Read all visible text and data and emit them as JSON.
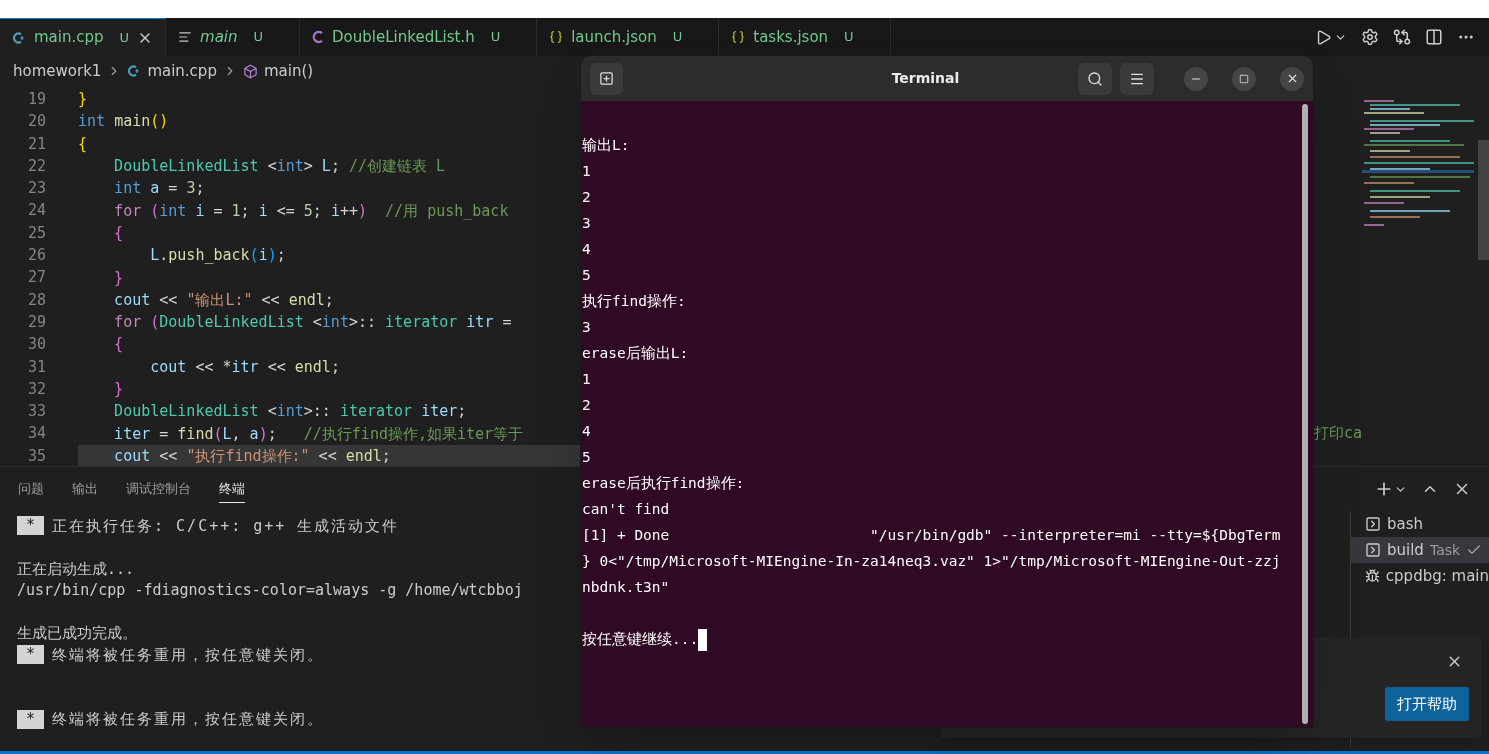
{
  "tabs": [
    {
      "label": "main.cpp",
      "badge": "U",
      "kind": "cpp",
      "selected": true,
      "preview": false
    },
    {
      "label": "main",
      "badge": "U",
      "kind": "list",
      "selected": false,
      "preview": true
    },
    {
      "label": "DoubleLinkedList.h",
      "badge": "U",
      "kind": "header",
      "selected": false,
      "preview": false
    },
    {
      "label": "launch.json",
      "badge": "U",
      "kind": "json",
      "selected": false,
      "preview": false
    },
    {
      "label": "tasks.json",
      "badge": "U",
      "kind": "json",
      "selected": false,
      "preview": false
    }
  ],
  "breadcrumb": [
    {
      "label": "homework1",
      "kind": "folder"
    },
    {
      "label": "main.cpp",
      "kind": "cpp"
    },
    {
      "label": "main()",
      "kind": "method"
    }
  ],
  "editor": {
    "lines": [
      {
        "number": "19",
        "current": false,
        "segments": [
          {
            "text": "}",
            "kind": "b1"
          }
        ]
      },
      {
        "number": "20",
        "current": false,
        "segments": [
          {
            "text": "int ",
            "kind": "kw"
          },
          {
            "text": "main",
            "kind": "fn"
          },
          {
            "text": "()",
            "kind": "b1"
          }
        ]
      },
      {
        "number": "21",
        "current": false,
        "segments": [
          {
            "text": "{",
            "kind": "b1"
          }
        ]
      },
      {
        "number": "22",
        "current": false,
        "segments": [
          {
            "text": "    DoubleLinkedList",
            "kind": "type"
          },
          {
            "text": " <",
            "kind": "plain"
          },
          {
            "text": "int",
            "kind": "kw"
          },
          {
            "text": "> ",
            "kind": "plain"
          },
          {
            "text": "L",
            "kind": "var"
          },
          {
            "text": "; ",
            "kind": "plain"
          },
          {
            "text": "//创建链表 L",
            "kind": "cmt"
          }
        ]
      },
      {
        "number": "23",
        "current": false,
        "segments": [
          {
            "text": "    int ",
            "kind": "kw"
          },
          {
            "text": "a",
            "kind": "var"
          },
          {
            "text": " = ",
            "kind": "plain"
          },
          {
            "text": "3",
            "kind": "num"
          },
          {
            "text": ";",
            "kind": "plain"
          }
        ]
      },
      {
        "number": "24",
        "current": false,
        "segments": [
          {
            "text": "    for ",
            "kind": "ctrl"
          },
          {
            "text": "(",
            "kind": "b2"
          },
          {
            "text": "int ",
            "kind": "kw"
          },
          {
            "text": "i",
            "kind": "var"
          },
          {
            "text": " = ",
            "kind": "plain"
          },
          {
            "text": "1",
            "kind": "num"
          },
          {
            "text": "; ",
            "kind": "plain"
          },
          {
            "text": "i",
            "kind": "var"
          },
          {
            "text": " <= ",
            "kind": "plain"
          },
          {
            "text": "5",
            "kind": "num"
          },
          {
            "text": "; ",
            "kind": "plain"
          },
          {
            "text": "i",
            "kind": "var"
          },
          {
            "text": "++",
            "kind": "plain"
          },
          {
            "text": ")",
            "kind": "b2"
          },
          {
            "text": "  //用 push_back",
            "kind": "cmt"
          }
        ]
      },
      {
        "number": "25",
        "current": false,
        "segments": [
          {
            "text": "    {",
            "kind": "b2"
          }
        ]
      },
      {
        "number": "26",
        "current": false,
        "segments": [
          {
            "text": "        L",
            "kind": "var"
          },
          {
            "text": ".",
            "kind": "plain"
          },
          {
            "text": "push_back",
            "kind": "fn"
          },
          {
            "text": "(",
            "kind": "b3"
          },
          {
            "text": "i",
            "kind": "var"
          },
          {
            "text": ")",
            "kind": "b3"
          },
          {
            "text": ";",
            "kind": "plain"
          }
        ]
      },
      {
        "number": "27",
        "current": false,
        "segments": [
          {
            "text": "    }",
            "kind": "b2"
          }
        ]
      },
      {
        "number": "28",
        "current": false,
        "segments": [
          {
            "text": "    cout",
            "kind": "var"
          },
          {
            "text": " << ",
            "kind": "plain"
          },
          {
            "text": "\"输出L:\"",
            "kind": "str"
          },
          {
            "text": " << ",
            "kind": "plain"
          },
          {
            "text": "endl",
            "kind": "fn"
          },
          {
            "text": ";",
            "kind": "plain"
          }
        ]
      },
      {
        "number": "29",
        "current": false,
        "segments": [
          {
            "text": "    for ",
            "kind": "ctrl"
          },
          {
            "text": "(",
            "kind": "b2"
          },
          {
            "text": "DoubleLinkedList",
            "kind": "type"
          },
          {
            "text": " <",
            "kind": "plain"
          },
          {
            "text": "int",
            "kind": "kw"
          },
          {
            "text": ">:: ",
            "kind": "plain"
          },
          {
            "text": "iterator ",
            "kind": "type"
          },
          {
            "text": "itr",
            "kind": "var"
          },
          {
            "text": " =",
            "kind": "plain"
          }
        ]
      },
      {
        "number": "30",
        "current": false,
        "segments": [
          {
            "text": "    {",
            "kind": "b2"
          }
        ]
      },
      {
        "number": "31",
        "current": false,
        "segments": [
          {
            "text": "        cout",
            "kind": "var"
          },
          {
            "text": " << *",
            "kind": "plain"
          },
          {
            "text": "itr",
            "kind": "var"
          },
          {
            "text": " << ",
            "kind": "plain"
          },
          {
            "text": "endl",
            "kind": "fn"
          },
          {
            "text": ";",
            "kind": "plain"
          }
        ]
      },
      {
        "number": "32",
        "current": false,
        "segments": [
          {
            "text": "    }",
            "kind": "b2"
          }
        ]
      },
      {
        "number": "33",
        "current": false,
        "segments": [
          {
            "text": "    DoubleLinkedList",
            "kind": "type"
          },
          {
            "text": " <",
            "kind": "plain"
          },
          {
            "text": "int",
            "kind": "kw"
          },
          {
            "text": ">:: ",
            "kind": "plain"
          },
          {
            "text": "iterator ",
            "kind": "type"
          },
          {
            "text": "iter",
            "kind": "var"
          },
          {
            "text": ";",
            "kind": "plain"
          }
        ]
      },
      {
        "number": "34",
        "current": false,
        "tail": "打印ca",
        "segments": [
          {
            "text": "    iter",
            "kind": "var"
          },
          {
            "text": " = ",
            "kind": "plain"
          },
          {
            "text": "find",
            "kind": "fn"
          },
          {
            "text": "(",
            "kind": "b2"
          },
          {
            "text": "L",
            "kind": "var"
          },
          {
            "text": ", ",
            "kind": "plain"
          },
          {
            "text": "a",
            "kind": "var"
          },
          {
            "text": ")",
            "kind": "b2"
          },
          {
            "text": ";",
            "kind": "plain"
          },
          {
            "text": "   //执行find操作,如果iter等于",
            "kind": "cmt"
          }
        ]
      },
      {
        "number": "35",
        "current": true,
        "segments": [
          {
            "text": "    cout",
            "kind": "var"
          },
          {
            "text": " << ",
            "kind": "plain"
          },
          {
            "text": "\"执行find操作:\"",
            "kind": "str"
          },
          {
            "text": " << ",
            "kind": "plain"
          },
          {
            "text": "endl",
            "kind": "fn"
          },
          {
            "text": ";",
            "kind": "plain"
          }
        ]
      }
    ]
  },
  "panel": {
    "tabs": [
      {
        "label": "问题",
        "selected": false
      },
      {
        "label": "输出",
        "selected": false
      },
      {
        "label": "调试控制台",
        "selected": false
      },
      {
        "label": "终端",
        "selected": true
      }
    ],
    "output": [
      {
        "kind": "task",
        "badge": "*",
        "text": "正在执行任务: C/C++: g++ 生成活动文件"
      },
      {
        "kind": "blank"
      },
      {
        "kind": "text",
        "text": "正在启动生成..."
      },
      {
        "kind": "text",
        "text": "/usr/bin/cpp -fdiagnostics-color=always -g /home/wtcbboj"
      },
      {
        "kind": "blank"
      },
      {
        "kind": "text",
        "text": "生成已成功完成。"
      },
      {
        "kind": "task",
        "badge": "*",
        "text": "终端将被任务重用，按任意键关闭。"
      },
      {
        "kind": "blank"
      },
      {
        "kind": "blank"
      },
      {
        "kind": "task",
        "badge": "*",
        "text": "终端将被任务重用，按任意键关闭。"
      }
    ],
    "sessions": [
      {
        "label": "bash",
        "kind": "shell",
        "selected": false,
        "done": false
      },
      {
        "label": "build",
        "note": "Task",
        "kind": "shell",
        "selected": true,
        "done": true
      },
      {
        "label": "cppdbg: main",
        "kind": "debug",
        "selected": false,
        "done": false
      }
    ]
  },
  "notification": {
    "button": "打开帮助"
  },
  "terminal_window": {
    "title": "Terminal",
    "cursor": true,
    "lines": [
      {
        "kind": "blank"
      },
      {
        "kind": "text",
        "text": "输出L:"
      },
      {
        "kind": "text",
        "text": "1"
      },
      {
        "kind": "text",
        "text": "2"
      },
      {
        "kind": "text",
        "text": "3"
      },
      {
        "kind": "text",
        "text": "4"
      },
      {
        "kind": "text",
        "text": "5"
      },
      {
        "kind": "text",
        "text": "执行find操作:"
      },
      {
        "kind": "text",
        "text": "3"
      },
      {
        "kind": "text",
        "text": "erase后输出L:"
      },
      {
        "kind": "text",
        "text": "1"
      },
      {
        "kind": "text",
        "text": "2"
      },
      {
        "kind": "text",
        "text": "4"
      },
      {
        "kind": "text",
        "text": "5"
      },
      {
        "kind": "text",
        "text": "erase后执行find操作:"
      },
      {
        "kind": "text",
        "text": "can't find"
      },
      {
        "kind": "text",
        "text": "[1] + Done                       \"/usr/bin/gdb\" --interpreter=mi --tty=${DbgTerm"
      },
      {
        "kind": "text",
        "text": "} 0<\"/tmp/Microsoft-MIEngine-In-za14neq3.vaz\" 1>\"/tmp/Microsoft-MIEngine-Out-zzj"
      },
      {
        "kind": "text",
        "text": "nbdnk.t3n\""
      },
      {
        "kind": "blank"
      },
      {
        "kind": "text",
        "text": "按任意键继续..."
      }
    ]
  }
}
